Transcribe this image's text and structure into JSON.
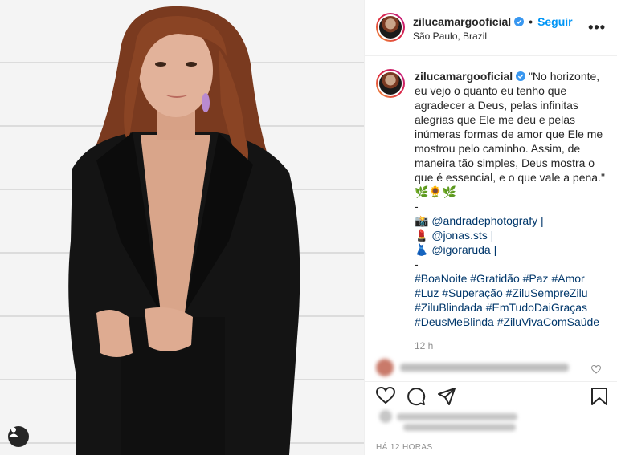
{
  "header": {
    "username": "zilucamargooficial",
    "follow_label": "Seguir",
    "separator": "•",
    "location": "São Paulo, Brazil",
    "more_label": "•••"
  },
  "caption": {
    "username": "zilucamargooficial",
    "quote_lines": [
      "\"No horizonte,",
      "eu vejo o quanto eu tenho que",
      "agradecer a Deus, pelas infinitas",
      "alegrias que Ele me deu e pelas",
      "inúmeras formas de amor que Ele me",
      "mostrou pelo caminho. Assim, de",
      "maneira tão simples, Deus mostra o",
      "que é essencial, e o que vale a pena.\""
    ],
    "emoji_line": "🌿🌻🌿",
    "dash": "-",
    "credits": [
      {
        "emoji": "📸",
        "text": "@andradephotografy |"
      },
      {
        "emoji": "💄",
        "text": "@jonas.sts |"
      },
      {
        "emoji": "👗",
        "text": "@igoraruda |"
      }
    ],
    "dash2": "-",
    "hashtag_lines": [
      "#BoaNoite #Gratidão #Paz #Amor",
      "#Luz #Superação #ZiluSempreZilu",
      "#ZiluBlindada #EmTudoDaiGraças",
      "#DeusMeBlinda #ZiluVivaComSaúde"
    ],
    "time": "12 h"
  },
  "footer": {
    "date": "HÁ 12 HORAS"
  },
  "colors": {
    "accent": "#0095f6",
    "link": "#00376b",
    "muted": "#8e8e8e"
  },
  "icons": [
    "verified-badge-icon",
    "heart-icon",
    "comment-icon",
    "share-icon",
    "bookmark-icon",
    "user-tag-icon",
    "more-icon"
  ]
}
